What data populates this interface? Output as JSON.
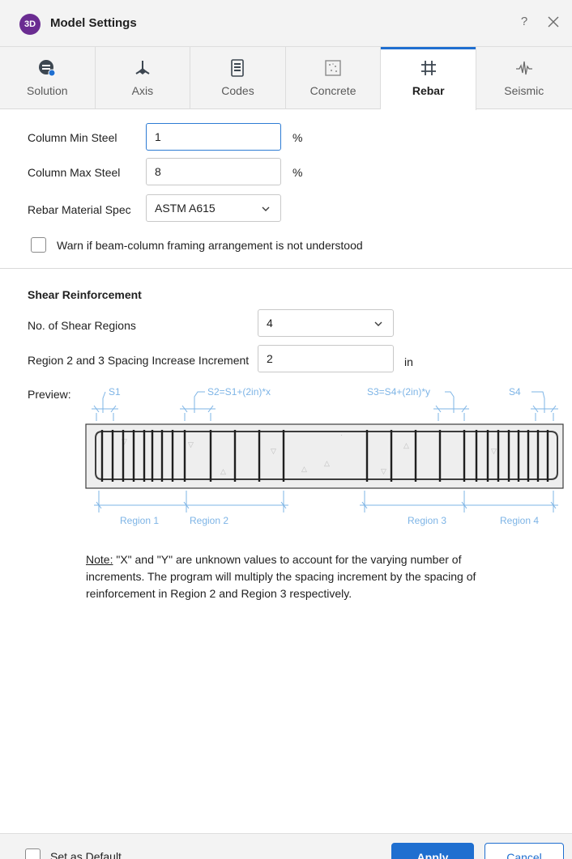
{
  "window": {
    "logo_text": "3D",
    "title": "Model Settings",
    "help_label": "?",
    "close_icon": "close-icon"
  },
  "tabs": [
    {
      "label": "Solution",
      "icon": "solution-icon",
      "active": false
    },
    {
      "label": "Axis",
      "icon": "axis-icon",
      "active": false
    },
    {
      "label": "Codes",
      "icon": "codes-icon",
      "active": false
    },
    {
      "label": "Concrete",
      "icon": "concrete-icon",
      "active": false
    },
    {
      "label": "Rebar",
      "icon": "rebar-icon",
      "active": true
    },
    {
      "label": "Seismic",
      "icon": "seismic-icon",
      "active": false
    }
  ],
  "rebar": {
    "column_min_steel": {
      "label": "Column Min Steel",
      "value": "1",
      "unit": "%"
    },
    "column_max_steel": {
      "label": "Column Max Steel",
      "value": "8",
      "unit": "%"
    },
    "material_spec": {
      "label": "Rebar Material Spec",
      "value": "ASTM A615"
    },
    "warn_checkbox": {
      "label": "Warn if beam-column framing arrangement is not understood",
      "checked": false
    }
  },
  "shear": {
    "section_title": "Shear Reinforcement",
    "regions": {
      "label": "No. of Shear Regions",
      "value": "4"
    },
    "spacing_increment": {
      "label": "Region 2 and 3 Spacing Increase Increment",
      "value": "2",
      "unit": "in"
    },
    "preview_label": "Preview:",
    "diagram": {
      "s1": "S1",
      "s2": "S2=S1+(2in)*x",
      "s3": "S3=S4+(2in)*y",
      "s4": "S4",
      "region1": "Region 1",
      "region2": "Region 2",
      "region3": "Region 3",
      "region4": "Region 4"
    },
    "note_prefix": "Note:",
    "note_text": " \"X\" and \"Y\" are unknown values to account for the varying number of increments. The program will multiply the spacing increment by the spacing of reinforcement in Region 2 and Region 3 respectively."
  },
  "footer": {
    "default_label": "Set as Default",
    "default_checked": false,
    "apply_label": "Apply",
    "cancel_label": "Cancel"
  },
  "colors": {
    "accent": "#1f6fd0",
    "logo": "#6a2c91",
    "diagram_blue": "#7db4e6"
  }
}
